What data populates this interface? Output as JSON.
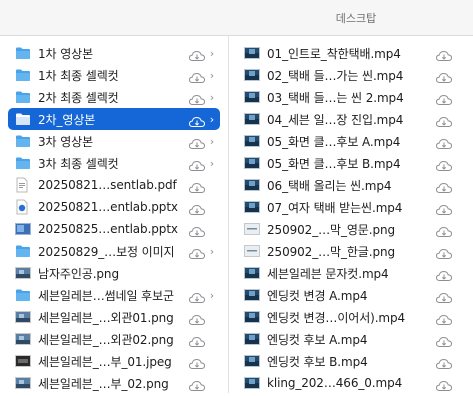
{
  "window": {
    "title": "데스크탑"
  },
  "left_column": [
    {
      "name": "1차 영상본",
      "kind": "folder",
      "cloud": true,
      "chevron": true
    },
    {
      "name": "1차 최종 셀렉컷",
      "kind": "folder",
      "cloud": true,
      "chevron": true
    },
    {
      "name": "2차 최종 셀렉컷",
      "kind": "folder",
      "cloud": true,
      "chevron": true
    },
    {
      "name": "2차_영상본",
      "kind": "folder",
      "cloud": true,
      "chevron": true,
      "selected": true
    },
    {
      "name": "3차 영상본",
      "kind": "folder",
      "cloud": true,
      "chevron": true
    },
    {
      "name": "3차 최종 셀렉컷",
      "kind": "folder",
      "cloud": true,
      "chevron": true
    },
    {
      "name": "20250821…sentlab.pdf",
      "kind": "pdf",
      "cloud": true
    },
    {
      "name": "20250821…entlab.pptx",
      "kind": "pptx",
      "cloud": true
    },
    {
      "name": "20250825…entlab.pptx",
      "kind": "pptx-thumb",
      "cloud": true
    },
    {
      "name": "20250829_…보정 이미지",
      "kind": "folder",
      "cloud": true,
      "chevron": true
    },
    {
      "name": "남자주인공.png",
      "kind": "image",
      "cloud": false
    },
    {
      "name": "세븐일레븐…썸네일 후보군",
      "kind": "folder",
      "cloud": true,
      "chevron": true
    },
    {
      "name": "세븐일레븐_…외관01.png",
      "kind": "image",
      "cloud": true
    },
    {
      "name": "세븐일레븐_…외관02.png",
      "kind": "image",
      "cloud": true
    },
    {
      "name": "세븐일레븐_…부_01.jpeg",
      "kind": "image-dark",
      "cloud": true
    },
    {
      "name": "세븐일레븐_…부_02.png",
      "kind": "image",
      "cloud": true
    }
  ],
  "right_column": [
    {
      "name": "01_인트로_착한택배.mp4",
      "kind": "video"
    },
    {
      "name": "02_택배 들…가는 씬.mp4",
      "kind": "video"
    },
    {
      "name": "03_택배 들…는 씬 2.mp4",
      "kind": "video"
    },
    {
      "name": "04_세븐 일…장 진입.mp4",
      "kind": "video"
    },
    {
      "name": "05_화면 클…후보 A.mp4",
      "kind": "video"
    },
    {
      "name": "05_화면 클…후보 B.mp4",
      "kind": "video"
    },
    {
      "name": "06_택배 올리는 씬.mp4",
      "kind": "video"
    },
    {
      "name": "07_여자 택배 받는씬.mp4",
      "kind": "video"
    },
    {
      "name": "250902_…막_영문.png",
      "kind": "image-light"
    },
    {
      "name": "250902_…막_한글.png",
      "kind": "image-light"
    },
    {
      "name": "세븐일레븐 문자컷.mp4",
      "kind": "video"
    },
    {
      "name": "엔딩컷 변경 A.mp4",
      "kind": "video"
    },
    {
      "name": "엔딩컷 변경…이어서).mp4",
      "kind": "video"
    },
    {
      "name": "엔딩컷 후보 A.mp4",
      "kind": "video"
    },
    {
      "name": "엔딩컷 후보 B.mp4",
      "kind": "video"
    },
    {
      "name": "kling_202…466_0.mp4",
      "kind": "video"
    }
  ],
  "colors": {
    "selection": "#1566d6",
    "folder": "#4aa3e8",
    "cloud_icon": "#8e8e93"
  }
}
